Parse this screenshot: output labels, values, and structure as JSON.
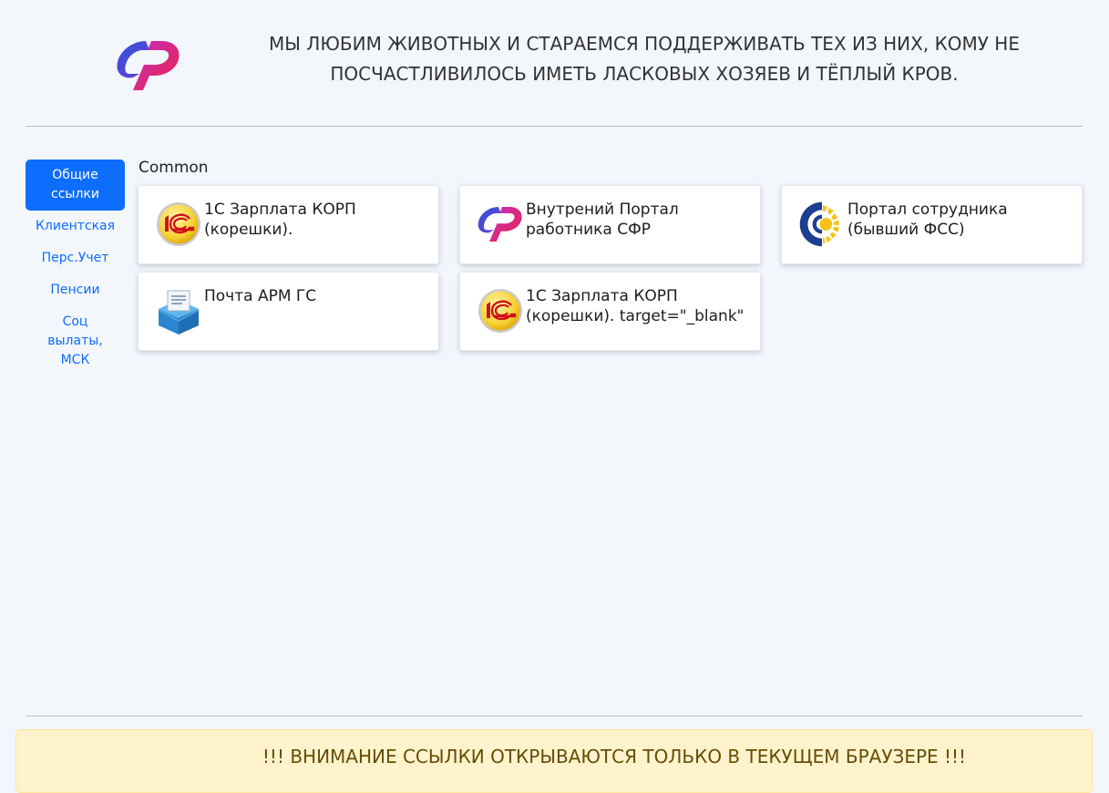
{
  "header": {
    "slogan_line1": "МЫ ЛЮБИМ ЖИВОТНЫХ И СТАРАЕМСЯ ПОДДЕРЖИВАТЬ ТЕХ ИЗ НИХ, КОМУ НЕ",
    "slogan_line2": "ПОСЧАСТЛИВИЛОСЬ ИМЕТЬ ЛАСКОВЫХ ХОЗЯЕВ И ТЁПЛЫЙ КРОВ.",
    "logo_icon": "sfr-logo-icon"
  },
  "nav": {
    "items": [
      {
        "line1": "Общие",
        "line2": "ссылки",
        "active": true
      },
      {
        "label": "Клиентская"
      },
      {
        "label": "Перс.Учет"
      },
      {
        "label": "Пенсии"
      },
      {
        "line1": "Соц",
        "line2": "вылаты,",
        "line3": "МСК"
      }
    ]
  },
  "section": {
    "title": "Common"
  },
  "cards": [
    {
      "line1": "1С Зарплата КОРП",
      "line2": "(корешки).",
      "icon": "1c-logo-icon"
    },
    {
      "line1": "Внутрений Портал",
      "line2": "работника СФР",
      "icon": "sfr-logo-icon"
    },
    {
      "line1": "Портал сотрудника",
      "line2": "(бывший ФСС)",
      "icon": "fss-logo-icon"
    },
    {
      "line1": "Почта АРМ ГС",
      "icon": "mail-box-icon"
    },
    {
      "line1": "1С Зарплата КОРП",
      "line2": "(корешки). target=\"_blank\"",
      "icon": "1c-logo-icon"
    }
  ],
  "alert": {
    "text": "!!! ВНИМАНИЕ ССЫЛКИ ОТКРЫВАЮТСЯ ТОЛЬКО В ТЕКУЩЕМ БРАУЗЕРЕ !!!"
  },
  "colors": {
    "accent": "#0d6efd",
    "background": "#f3f7fc",
    "alert_bg": "#fff3cd",
    "alert_text": "#664d03"
  }
}
